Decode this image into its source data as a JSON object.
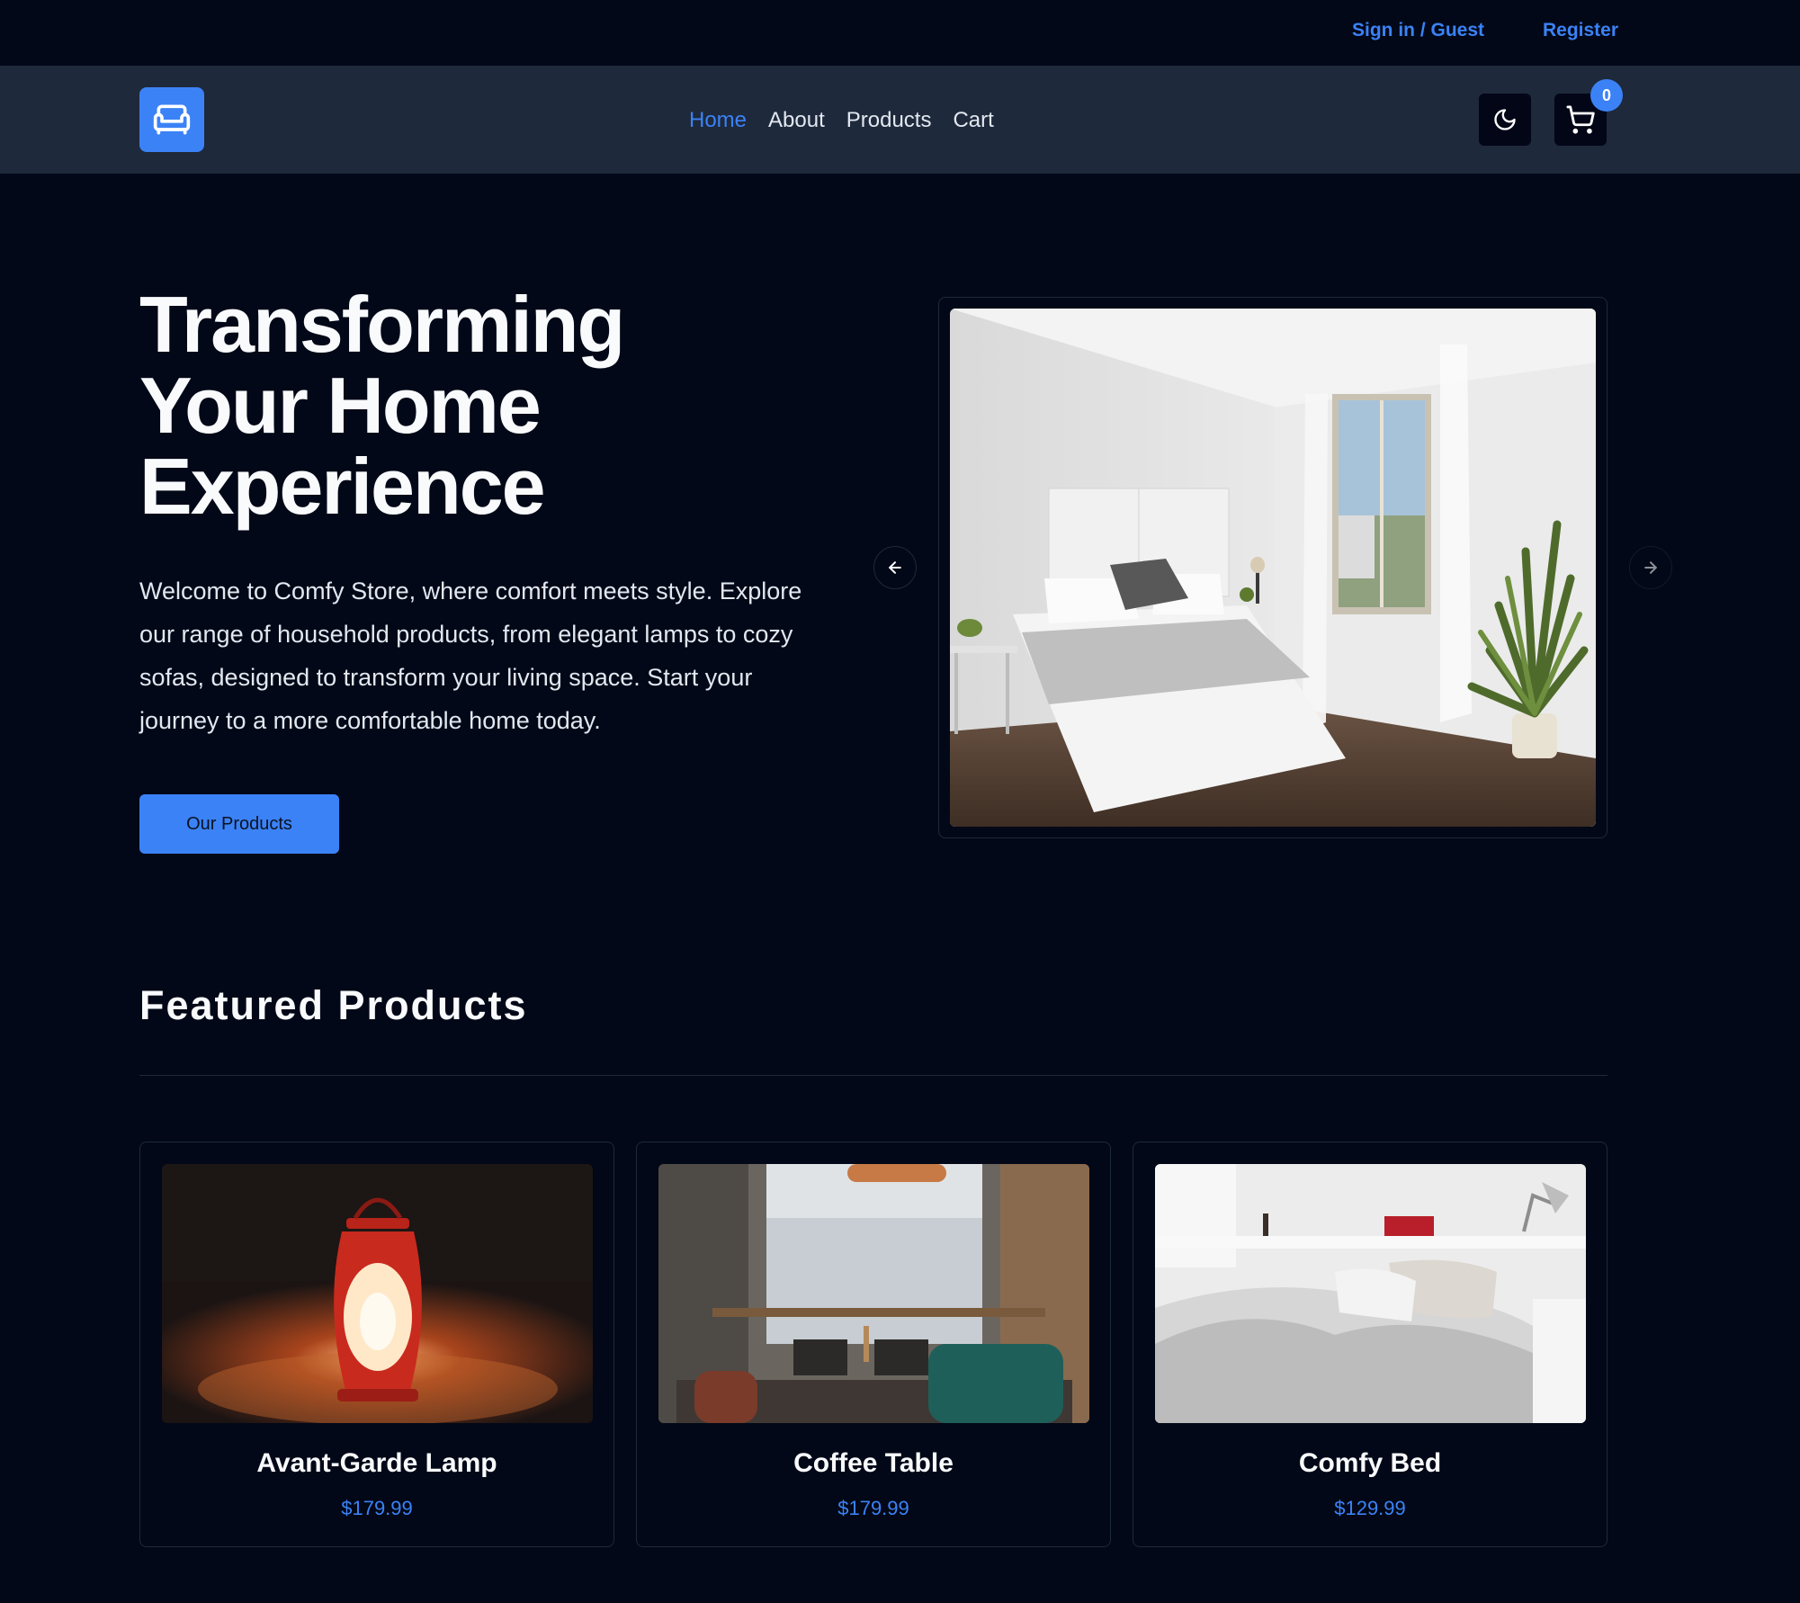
{
  "topbar": {
    "signin_label": "Sign in / Guest",
    "register_label": "Register"
  },
  "navbar": {
    "logo_icon": "sofa-icon",
    "links": [
      {
        "label": "Home",
        "active": true
      },
      {
        "label": "About",
        "active": false
      },
      {
        "label": "Products",
        "active": false
      },
      {
        "label": "Cart",
        "active": false
      }
    ],
    "theme_icon": "moon-icon",
    "cart_icon": "shopping-cart-icon",
    "cart_count": "0"
  },
  "hero": {
    "title_line1": "Transforming",
    "title_line2": "Your Home",
    "title_line3": "Experience",
    "description": "Welcome to Comfy Store, where comfort meets style. Explore our range of household products, from elegant lamps to cozy sofas, designed to transform your living space. Start your journey to a more comfortable home today.",
    "cta_label": "Our Products"
  },
  "carousel": {
    "prev_icon": "arrow-left-icon",
    "next_icon": "arrow-right-icon"
  },
  "featured": {
    "title": "Featured Products",
    "products": [
      {
        "name": "Avant-Garde Lamp",
        "price": "$179.99"
      },
      {
        "name": "Coffee Table",
        "price": "$179.99"
      },
      {
        "name": "Comfy Bed",
        "price": "$129.99"
      }
    ]
  },
  "colors": {
    "background": "#020817",
    "navbar": "#1e293b",
    "accent": "#3b82f6"
  }
}
